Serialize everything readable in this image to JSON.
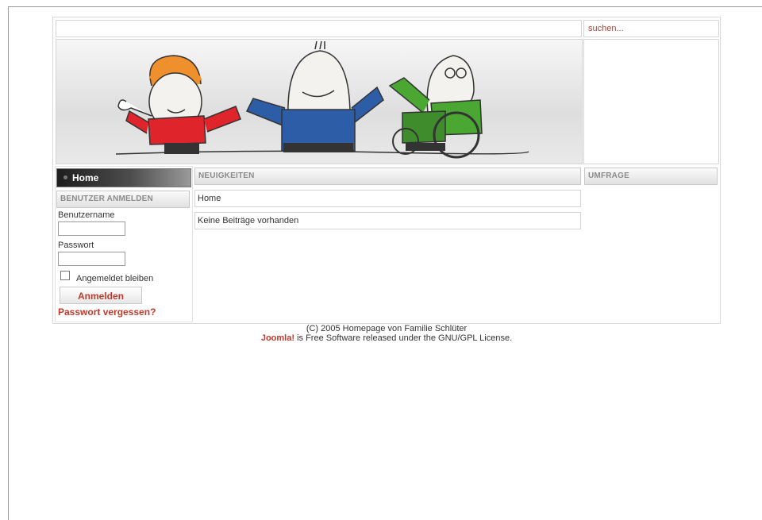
{
  "search": {
    "placeholder_text": "suchen..."
  },
  "menu": {
    "home_label": "Home"
  },
  "login": {
    "heading": "BENUTZER ANMELDEN",
    "username_label": "Benutzername",
    "username_value": "",
    "password_label": "Passwort",
    "password_value": "",
    "remember_label": "Angemeldet bleiben",
    "remember_checked": false,
    "submit_label": "Anmelden",
    "forgot_label": "Passwort vergessen?"
  },
  "news": {
    "heading": "NEUIGKEITEN",
    "rows": [
      "Home",
      "Keine Beiträge vorhanden"
    ]
  },
  "poll": {
    "heading": "UMFRAGE"
  },
  "footer": {
    "copyright": "(C) 2005 Homepage von Familie Schlüter",
    "brand": "Joomla!",
    "license": " is Free Software released under the GNU/GPL License."
  },
  "colors": {
    "accent_red": "#c0392b",
    "border_gray": "#d4d4d4",
    "menu_dark": "#1e1e1e"
  }
}
